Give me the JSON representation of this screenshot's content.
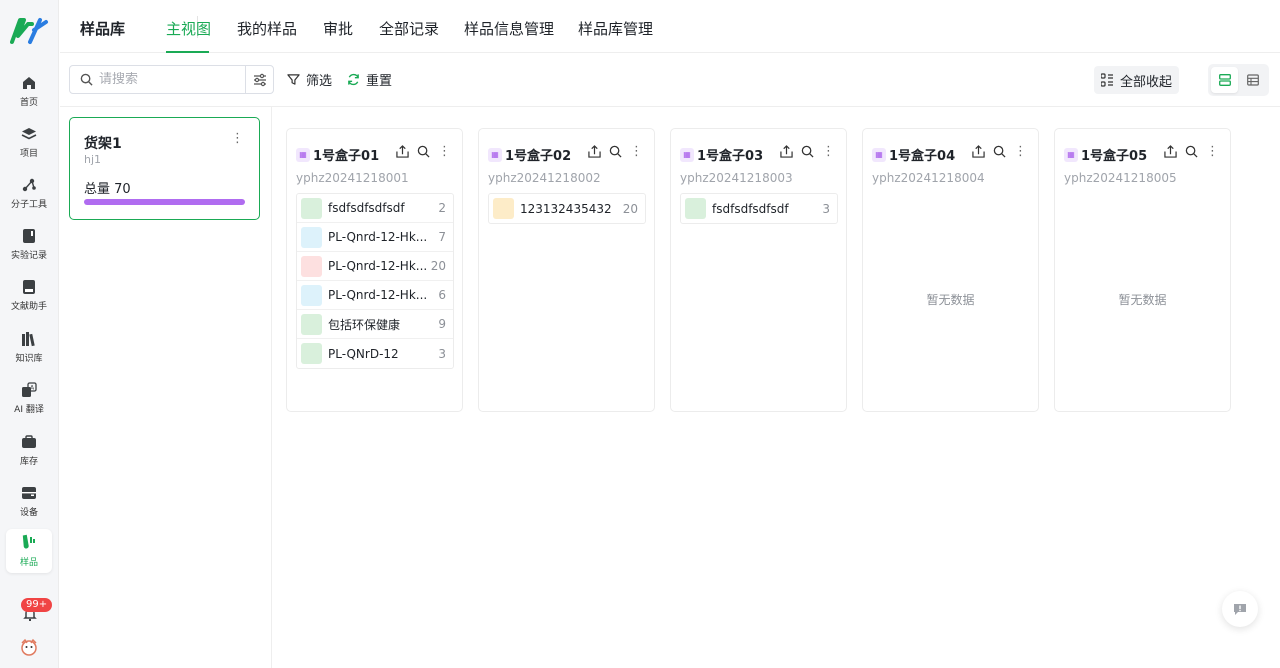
{
  "colors": {
    "accent": "#1aaa55",
    "shelf_bar": "#b06cf0",
    "box_icon": "#a455ea"
  },
  "rail": {
    "items": [
      {
        "label": "首页",
        "icon": "home-icon"
      },
      {
        "label": "项目",
        "icon": "layers-icon"
      },
      {
        "label": "分子工具",
        "icon": "molecule-icon"
      },
      {
        "label": "实验记录",
        "icon": "notebook-icon"
      },
      {
        "label": "文献助手",
        "icon": "book-icon"
      },
      {
        "label": "知识库",
        "icon": "library-icon"
      },
      {
        "label": "AI 翻译",
        "icon": "translate-icon"
      },
      {
        "label": "库存",
        "icon": "inventory-icon"
      },
      {
        "label": "设备",
        "icon": "device-icon"
      },
      {
        "label": "样品",
        "icon": "sample-icon"
      }
    ],
    "notify_badge": "99+"
  },
  "header": {
    "title": "样品库",
    "tabs": [
      "主视图",
      "我的样品",
      "审批",
      "全部记录",
      "样品信息管理",
      "样品库管理"
    ]
  },
  "toolbar": {
    "search_placeholder": "请搜索",
    "filter_label": "筛选",
    "reset_label": "重置",
    "collapse_label": "全部收起"
  },
  "shelf": {
    "name": "货架1",
    "code": "hj1",
    "total": "总量 70",
    "fill": 1.0
  },
  "boxes": [
    {
      "name": "1号盒子01",
      "code": "yphz20241218001",
      "items": [
        {
          "name": "fsdfsdfsdfsdf",
          "qty": "2",
          "color": "#d9f0dc"
        },
        {
          "name": "PL-Qnrd-12-Hk...",
          "qty": "7",
          "color": "#ddf2fb"
        },
        {
          "name": "PL-Qnrd-12-Hk...",
          "qty": "20",
          "color": "#fde0e0"
        },
        {
          "name": "PL-Qnrd-12-Hk...",
          "qty": "6",
          "color": "#ddf2fb"
        },
        {
          "name": "包括环保健康",
          "qty": "9",
          "color": "#d9f0dc"
        },
        {
          "name": "PL-QNrD-12",
          "qty": "3",
          "color": "#d9f0dc"
        }
      ]
    },
    {
      "name": "1号盒子02",
      "code": "yphz20241218002",
      "items": [
        {
          "name": "123132435432",
          "qty": "20",
          "color": "#fdecc8"
        }
      ]
    },
    {
      "name": "1号盒子03",
      "code": "yphz20241218003",
      "items": [
        {
          "name": "fsdfsdfsdfsdf",
          "qty": "3",
          "color": "#d9f0dc"
        }
      ]
    },
    {
      "name": "1号盒子04",
      "code": "yphz20241218004",
      "items": []
    },
    {
      "name": "1号盒子05",
      "code": "yphz20241218005",
      "items": []
    }
  ],
  "empty_text": "暂无数据"
}
